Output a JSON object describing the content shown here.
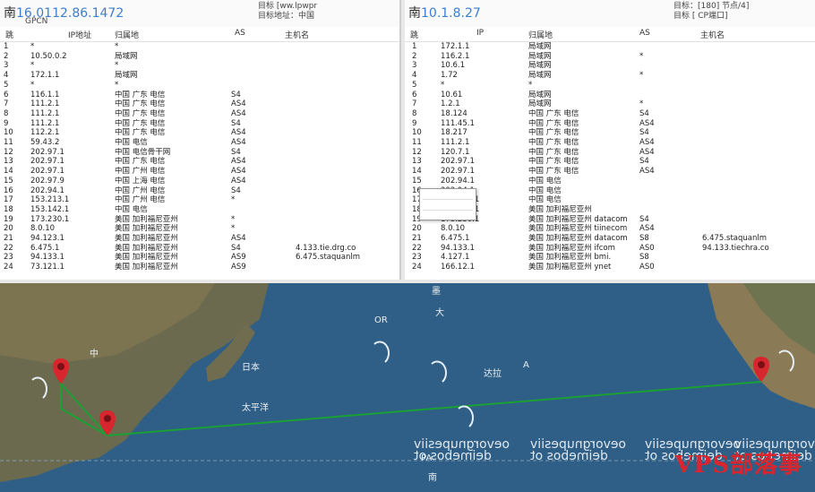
{
  "left": {
    "title_prefix": "南",
    "title_ip": "16.0112.86.1472",
    "sub_line1": "目标 [ww.lpwpr",
    "sub_line2": "目标地址：中国",
    "sub_line3": "GPCN",
    "columns": [
      "跳",
      "IP地址",
      "归属地",
      "AS",
      "主机名"
    ],
    "rows": [
      [
        "1",
        "*",
        "*",
        "",
        ""
      ],
      [
        "2",
        "10.50.0.2",
        "局域网",
        "",
        ""
      ],
      [
        "3",
        "*",
        "*",
        "",
        ""
      ],
      [
        "4",
        "172.1.1",
        "局域网",
        "",
        ""
      ],
      [
        "5",
        "*",
        "*",
        "",
        ""
      ],
      [
        "6",
        "116.1.1",
        "中国 广东 电信",
        "S4",
        ""
      ],
      [
        "7",
        "111.2.1",
        "中国 广东 电信",
        "AS4",
        ""
      ],
      [
        "8",
        "111.2.1",
        "中国 广东 电信",
        "AS4",
        ""
      ],
      [
        "9",
        "111.2.1",
        "中国 广东 电信",
        "S4",
        ""
      ],
      [
        "10",
        "112.2.1",
        "中国 广东 电信",
        "AS4",
        ""
      ],
      [
        "11",
        "59.43.2",
        "中国 电信",
        "AS4",
        ""
      ],
      [
        "12",
        "202.97.1",
        "中国 电信骨干网",
        "S4",
        ""
      ],
      [
        "13",
        "202.97.1",
        "中国 广东 电信",
        "AS4",
        ""
      ],
      [
        "14",
        "202.97.1",
        "中国 广州 电信",
        "AS4",
        ""
      ],
      [
        "15",
        "202.97.9",
        "中国 上海 电信",
        "AS4",
        ""
      ],
      [
        "16",
        "202.94.1",
        "中国 广州 电信",
        "S4",
        ""
      ],
      [
        "17",
        "153.213.1",
        "中国 广州 电信",
        "*",
        ""
      ],
      [
        "18",
        "153.142.1",
        "中国 电信",
        "",
        ""
      ],
      [
        "19",
        "173.230.1",
        "美国 加利福尼亚州",
        "*",
        ""
      ],
      [
        "20",
        "8.0.10",
        "美国 加利福尼亚州",
        "*",
        ""
      ],
      [
        "21",
        "94.123.1",
        "美国 加利福尼亚州",
        "AS4",
        ""
      ],
      [
        "22",
        "6.475.1",
        "美国 加利福尼亚州",
        "S4",
        "4.133.tie.drg.co"
      ],
      [
        "23",
        "94.133.1",
        "美国 加利福尼亚州",
        "AS9",
        "6.475.staquanlm"
      ],
      [
        "24",
        "73.121.1",
        "美国 加利福尼亚州",
        "AS9",
        ""
      ]
    ]
  },
  "right": {
    "title_prefix": "南",
    "title_ip": "10.1.8.27",
    "sub_line1": "目标：[180] 节点/4]",
    "sub_line2": "目标 [ CP端口]",
    "columns": [
      "跳",
      "IP",
      "归属地",
      "AS",
      "主机名"
    ],
    "rows": [
      [
        "1",
        "172.1.1",
        "局域网",
        "",
        ""
      ],
      [
        "2",
        "116.2.1",
        "局域网",
        "*",
        ""
      ],
      [
        "3",
        "10.6.1",
        "局域网",
        "",
        ""
      ],
      [
        "4",
        "1.72",
        "局域网",
        "*",
        ""
      ],
      [
        "5",
        "*",
        "*",
        "",
        ""
      ],
      [
        "6",
        "10.61",
        "局域网",
        "",
        ""
      ],
      [
        "7",
        "1.2.1",
        "局域网",
        "*",
        ""
      ],
      [
        "8",
        "18.124",
        "中国 广东 电信",
        "S4",
        ""
      ],
      [
        "9",
        "111.45.1",
        "中国 广东 电信",
        "AS4",
        ""
      ],
      [
        "10",
        "18.217",
        "中国 广东 电信",
        "S4",
        ""
      ],
      [
        "11",
        "111.2.1",
        "中国 广东 电信",
        "AS4",
        ""
      ],
      [
        "12",
        "120.7.1",
        "中国 广东 电信",
        "AS4",
        ""
      ],
      [
        "13",
        "202.97.1",
        "中国 广东 电信",
        "S4",
        ""
      ],
      [
        "14",
        "202.97.1",
        "中国 广东 电信",
        "AS4",
        ""
      ],
      [
        "15",
        "202.94.1",
        "中国 电信",
        "",
        ""
      ],
      [
        "16",
        "202.94.1",
        "中国 电信",
        "",
        ""
      ],
      [
        "17",
        "153.213.1",
        "中国 电信",
        "",
        ""
      ],
      [
        "18",
        "153.142.1",
        "美国 加利福尼亚州",
        "",
        ""
      ],
      [
        "19",
        "173.230.1",
        "美国 加利福尼亚州 datacom",
        "S4",
        ""
      ],
      [
        "20",
        "8.0.10",
        "美国 加利福尼亚州 tiinecom",
        "AS4",
        ""
      ],
      [
        "21",
        "6.475.1",
        "美国 加利福尼亚州 datacom",
        "S8",
        "6.475.staquanlm"
      ],
      [
        "22",
        "94.133.1",
        "美国 加利福尼亚州 ifcom",
        "AS0",
        "94.133.tiechra.co"
      ],
      [
        "23",
        "4.127.1",
        "美国 加利福尼亚州 bmi.",
        "S8",
        ""
      ],
      [
        "24",
        "166.12.1",
        "美国 加利福尼亚州 ynet",
        "AS0",
        ""
      ]
    ]
  },
  "map": {
    "labels": [
      "中",
      "日本",
      "太平洋",
      "墨",
      "大",
      "达拉",
      "A",
      "OR",
      "PA",
      "南"
    ],
    "mirror_texts": [
      "deimebos ot",
      "deimebos ot",
      "deimebos ot",
      "deimebos ot",
      "oevorgnupesiiv",
      "oevorgnupesiiv",
      "oevorgnupesiiv",
      "oevorgnupesiiv"
    ],
    "watermark": "VPS部落事",
    "route_color": "#1aa034",
    "pin_color": "#d8262e"
  }
}
